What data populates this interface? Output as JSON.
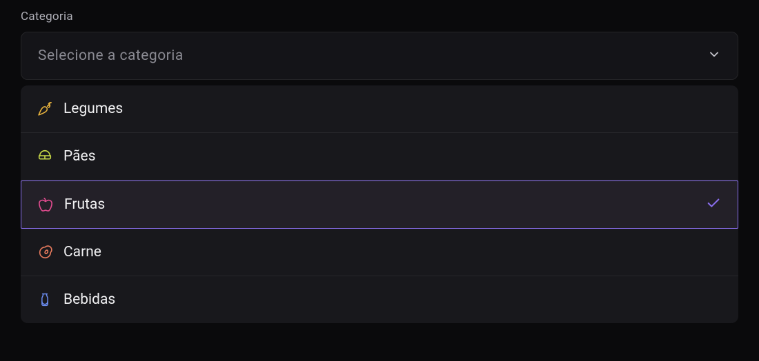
{
  "field": {
    "label": "Categoria",
    "placeholder": "Selecione a categoria"
  },
  "options": [
    {
      "label": "Legumes",
      "icon": "carrot-icon",
      "color": "#e4b03d",
      "highlighted": false,
      "selected": false
    },
    {
      "label": "Pães",
      "icon": "sandwich-icon",
      "color": "#c5d647",
      "highlighted": false,
      "selected": false
    },
    {
      "label": "Frutas",
      "icon": "apple-icon",
      "color": "#e14b8f",
      "highlighted": true,
      "selected": true
    },
    {
      "label": "Carne",
      "icon": "meat-icon",
      "color": "#e77a5d",
      "highlighted": false,
      "selected": false
    },
    {
      "label": "Bebidas",
      "icon": "milk-icon",
      "color": "#6b8cf0",
      "highlighted": false,
      "selected": false
    }
  ],
  "colors": {
    "accent": "#8b6ff0"
  }
}
